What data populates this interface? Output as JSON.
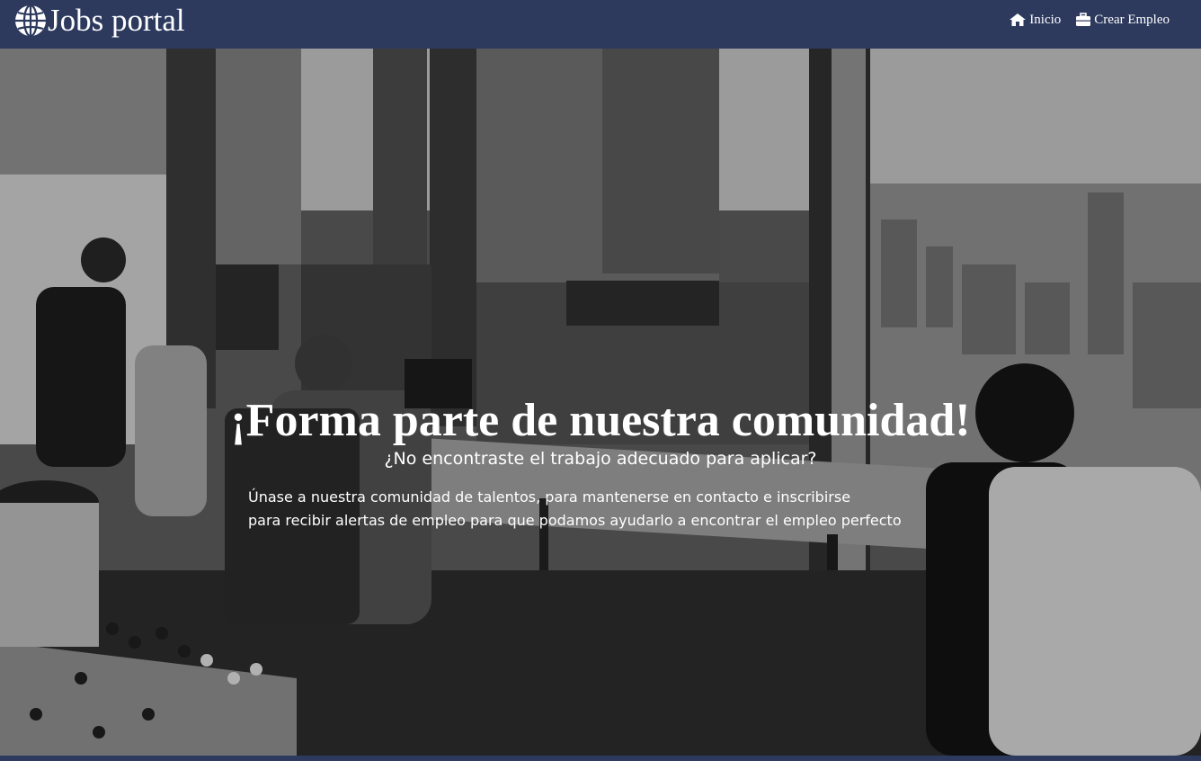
{
  "navbar": {
    "brand_text": "Jobs portal",
    "brand_icon": "globe-icon",
    "links": [
      {
        "label": "Inicio",
        "icon": "home-icon"
      },
      {
        "label": "Crear Empleo",
        "icon": "briefcase-icon"
      }
    ],
    "background_color": "#2d3a5e"
  },
  "hero": {
    "title": "¡Forma parte de nuestra comunidad!",
    "subtitle": "¿No encontraste el trabajo adecuado para aplicar?",
    "body_line_1": "Únase a nuestra comunidad de talentos, para mantenerse en contacto e inscribirse",
    "body_line_2": "para recibir alertas de empleo para que podamos ayudarlo a encontrar el empleo perfecto",
    "background_image": "grayscale office with people working at desks by large windows overlooking a city"
  }
}
